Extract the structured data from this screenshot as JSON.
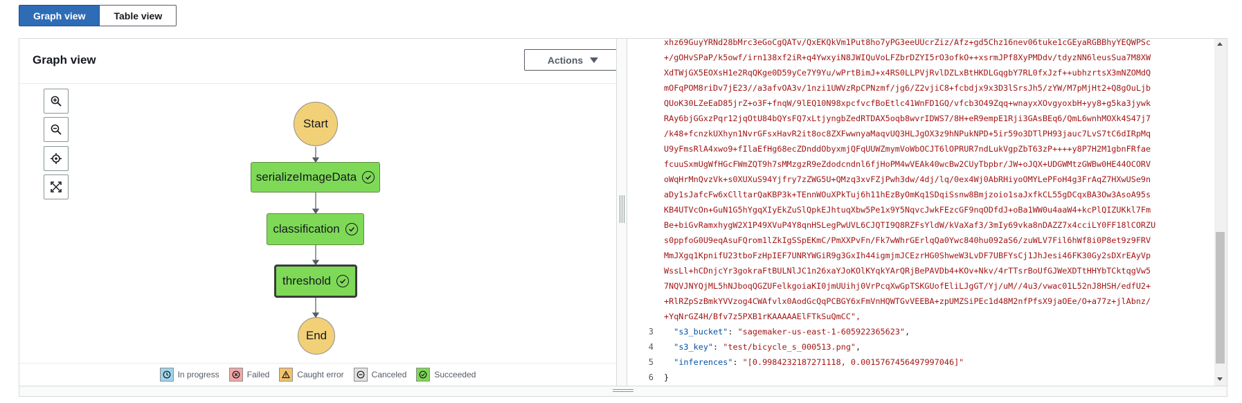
{
  "view_toggle": {
    "graph_label": "Graph view",
    "table_label": "Table view"
  },
  "graph": {
    "title": "Graph view",
    "actions_label": "Actions",
    "nodes": {
      "start": "Start",
      "serialize": "serializeImageData",
      "classification": "classification",
      "threshold": "threshold",
      "end": "End"
    },
    "controls": [
      "zoom-in-icon",
      "zoom-out-icon",
      "center-icon",
      "fit-screen-icon"
    ]
  },
  "legend": [
    {
      "label": "In progress",
      "icon": "clock-icon",
      "color": "#9fd4ec"
    },
    {
      "label": "Failed",
      "icon": "x-icon",
      "color": "#f0a8a8"
    },
    {
      "label": "Caught error",
      "icon": "warning-icon",
      "color": "#f5c26b"
    },
    {
      "label": "Canceled",
      "icon": "minus-icon",
      "color": "#e2e2e2"
    },
    {
      "label": "Succeeded",
      "icon": "check-icon",
      "color": "#7ed957"
    }
  ],
  "colors": {
    "success": "#7ed957",
    "terminal": "#f2d077",
    "accent": "#2f6cb6",
    "string": "#a31515",
    "key": "#0451a5"
  },
  "code": {
    "body_lines": [
      "xhz69GuyYRNd28bMrc3eGoCgQATv/QxEKQkVm1Put8ho7yPG3eeUUcrZiz/Afz+gd5Chz16nev06tuke1cGEyaRGBBhyYEQWPSc",
      "+/gOHvSPaP/k5owf/irn138xf2iR+q4YwxyiN8JWIQuVoLFZbrDZYI5rO3ofkO++xsrmJPf8XyPMDdv/tdyzNN6leusSua7M8XW",
      "XdTWjGX5EOXsH1e2RqQKge0D59yCe7Y9Yu/wPrtBimJ+x4RS0LLPVjRvlDZLxBtHKDLGqgbY7RL0fxJzf++ubhzrtsX3mNZOMdQ",
      "mOFqPOM8riDv7jE23//a3afvOA3v/1nzi1UWVzRpCPNzmf/jg6/Z2vjiC8+fcbdjx9x3D3lSrsJh5/zYW/M7pMjHt2+Q8gOuLjb",
      "QUoK30LZeEaD85jrZ+o3F+fnqW/9lEQ10N98xpcfvcfBoEtlc41WnFD1GQ/vfcb3O49Zqq+wnayxXOvgyoxbH+yy8+g5ka3jywk",
      "RAy6bjGGxzPqr12jqOtU84bQYsFQ7xLtjyngbZedRTDAX5oqb8wvrIDWS7/8H+eR9empE1Rji3GAsBEq6/QmL6wnhMOXk4S47j7",
      "/k48+fcnzkUXhyn1NvrGFsxHavR2it8oc8ZXFwwnyaMaqvUQ3HLJgOX3z9hNPukNPD+5ir59o3DTlPH93jauc7LvS7tC6dIRpMq",
      "U9yFmsRlA4xwo9+fIlaEfHg68ecZDnddObyxmjQFqUUWZmymVoWbOCJT6lOPRUR7ndLukVgpZbT63zP++++y8P7H2M1gbnFRfae",
      "fcuuSxmUgWfHGcFWmZQT9h7sMMzgzR9eZdodcndnl6fjHoPM4wVEAk40wcBw2CUyTbpbr/JW+oJQX+UDGWMtzGWBw0HE44OCORV",
      "oWqHrMnQvzVk+s0XUXuS94Yjfry7zZWG5U+QMzq3xvFZjPwh3dw/4dj/lq/0ex4Wj0AbRHiyoOMYLePFoH4g3FrAqZ7HXwUSe9n",
      "aDy1sJafcFw6xClltarQaKBP3k+TEnnWOuXPkTuj6h11hEzByOmKq1SDqiSsnw8Bmjzoio1saJxfkCL55gDCqxBA3Ow3AsoA95s",
      "KB4UTVcOn+GuN1G5hYgqXIyEkZuSlQpkEJhtuqXbw5Pe1x9Y5NqvcJwkFEzcGF9nqODfdJ+oBa1WW0u4aaW4+kcPlQIZUKkl7Fm",
      "Be+biGvRamxhygW2X1P49XVuP4Y8qnHSLegPwUVL6CJQTI9Q8RZFsYldW/kVaXaf3/3mIy69vka8nDAZZ7x4cciLY0FF18lCORZU",
      "s0ppfoG0U9eqAsuFQrom1lZkIgSSpEKmC/PmXXPvFn/Fk7wWhrGErlqQa0Ywc840hu092aS6/zuWLV7Fil6hWf8i0P8et9z9FRV",
      "MmJXgq1KpnifU23tboFzHpIEF7UNRYWGiR9g3GxIh44igmjmJCEzrHG0ShweW3LvDF7UBFYsCj1JhJesi46FK30Gy2sDXrEAyVp",
      "WssLl+hCDnjcYr3gokraFtBULNlJC1n26xaYJoKOlKYqkYArQRjBePAVDb4+KOv+Nkv/4rTTsrBoUfGJWeXDTtHHYbTCktqgVw5",
      "7NQVJNYQjML5hNJboqQGZUFelkgoiaKI0jmUUihj0VrPcqXwGpTSKGUofEliLJgGT/Yj/uM//4u3/vwac01L52nJ8HSH/edfU2+",
      "+RlRZpSzBmkYVVzog4CWAfvlx0AodGcQqPCBGY6xFmVnHQWTGvVEEBA+zpUMZSiPEc1d48M2nfPfsX9jaOEe/O+a77z+jlAbnz/",
      "+YqNrGZ4H/Bfv7z5PXB1rKAAAAAElFTkSuQmCC\","
    ],
    "numbered": [
      {
        "n": "3",
        "key": "\"s3_bucket\"",
        "value": "\"sagemaker-us-east-1-605922365623\"",
        "tail": ","
      },
      {
        "n": "4",
        "key": "\"s3_key\"",
        "value": "\"test/bicycle_s_000513.png\"",
        "tail": ","
      },
      {
        "n": "5",
        "key": "\"inferences\"",
        "value": "\"[0.9984232187271118, 0.0015767456497997046]\"",
        "tail": ""
      },
      {
        "n": "6",
        "key": "",
        "value": "",
        "tail": "}"
      }
    ]
  }
}
